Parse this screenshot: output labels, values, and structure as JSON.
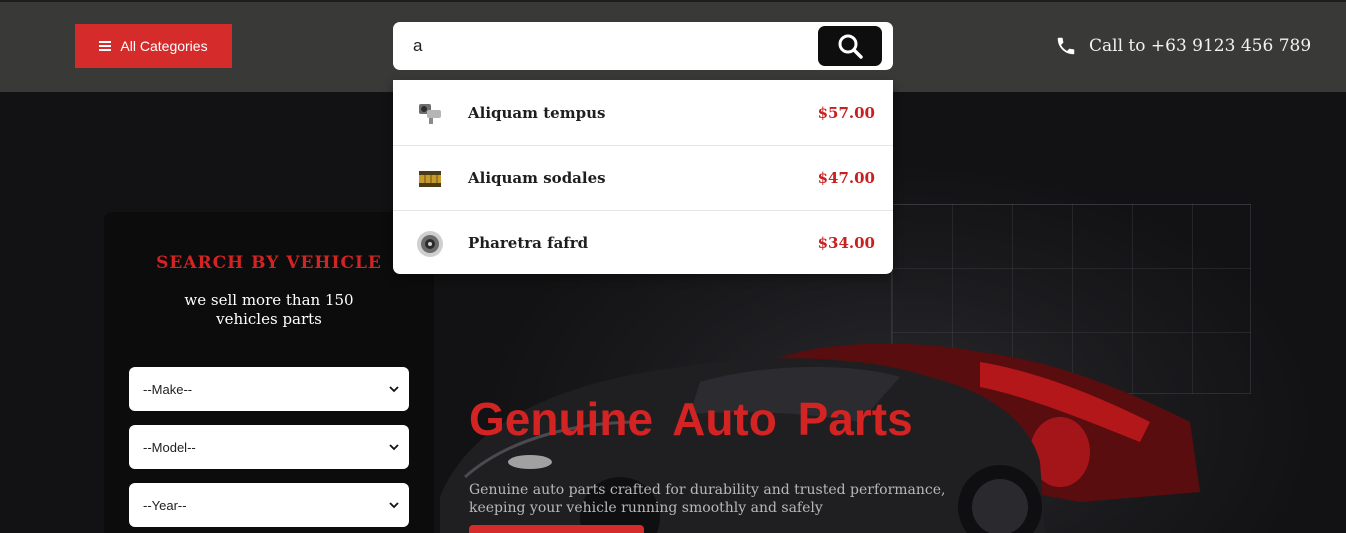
{
  "header": {
    "categories_label": "All Categories",
    "search": {
      "value": "a",
      "placeholder": ""
    },
    "call_text": "Call to +63 9123 456 789"
  },
  "search_results": [
    {
      "name": "Aliquam tempus",
      "price": "$57.00",
      "thumb": "brake-caliper-icon"
    },
    {
      "name": "Aliquam sodales",
      "price": "$47.00",
      "thumb": "oil-filter-icon"
    },
    {
      "name": "Pharetra fafrd",
      "price": "$34.00",
      "thumb": "brake-disc-icon"
    }
  ],
  "vehicle_search": {
    "title": "SEARCH BY VEHICLE",
    "subtitle_line1": "we sell more than 150",
    "subtitle_line2": "vehicles parts",
    "make": "--Make--",
    "model": "--Model--",
    "year": "--Year--"
  },
  "hero": {
    "title": "Genuine Auto Parts",
    "subtitle": "Genuine auto parts crafted for durability and trusted performance, keeping your vehicle running smoothly and safely"
  },
  "colors": {
    "accent": "#d52b2b",
    "header_bg": "#393938",
    "price": "#c91f1f"
  }
}
